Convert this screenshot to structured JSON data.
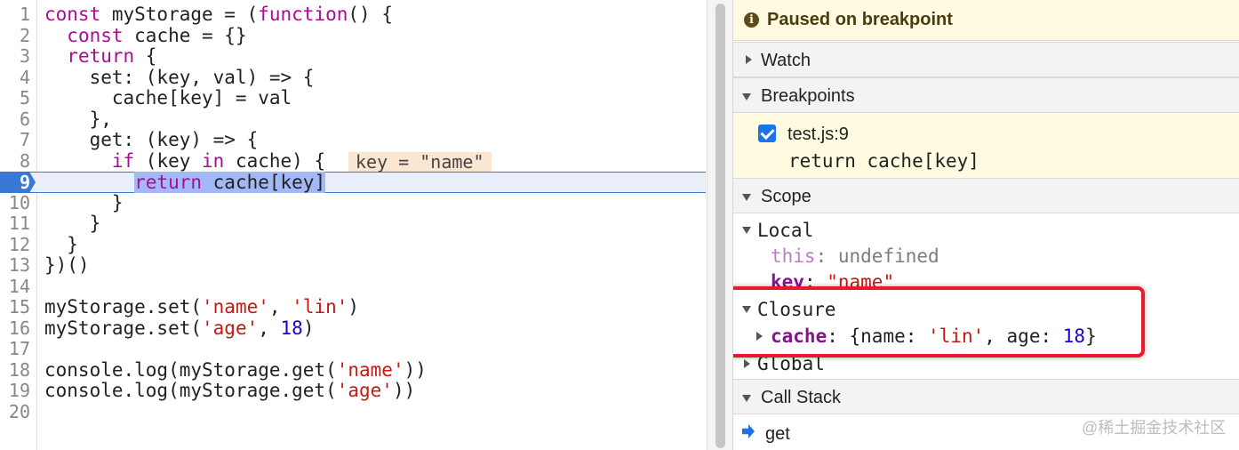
{
  "editor": {
    "lines": [
      {
        "n": "1",
        "tokens": [
          {
            "t": "const",
            "c": "kw"
          },
          {
            "t": " myStorage = ("
          },
          {
            "t": "function",
            "c": "kw"
          },
          {
            "t": "() {"
          }
        ]
      },
      {
        "n": "2",
        "tokens": [
          {
            "t": "  "
          },
          {
            "t": "const",
            "c": "kw"
          },
          {
            "t": " cache = {}"
          }
        ]
      },
      {
        "n": "3",
        "tokens": [
          {
            "t": "  "
          },
          {
            "t": "return",
            "c": "kw"
          },
          {
            "t": " {"
          }
        ]
      },
      {
        "n": "4",
        "tokens": [
          {
            "t": "    set: (key, val) => {"
          }
        ]
      },
      {
        "n": "5",
        "tokens": [
          {
            "t": "      cache[key] = val"
          }
        ]
      },
      {
        "n": "6",
        "tokens": [
          {
            "t": "    },"
          }
        ]
      },
      {
        "n": "7",
        "tokens": [
          {
            "t": "    get: (key) => {"
          }
        ]
      },
      {
        "n": "8",
        "tokens": [
          {
            "t": "      "
          },
          {
            "t": "if",
            "c": "kw"
          },
          {
            "t": " (key "
          },
          {
            "t": "in",
            "c": "kw"
          },
          {
            "t": " cache) {"
          }
        ]
      },
      {
        "n": "9",
        "tokens": [
          {
            "t": "        "
          },
          {
            "t": "return",
            "c": "kw"
          },
          {
            "t": " cache[key]"
          }
        ]
      },
      {
        "n": "10",
        "tokens": [
          {
            "t": "      }"
          }
        ]
      },
      {
        "n": "11",
        "tokens": [
          {
            "t": "    }"
          }
        ]
      },
      {
        "n": "12",
        "tokens": [
          {
            "t": "  }"
          }
        ]
      },
      {
        "n": "13",
        "tokens": [
          {
            "t": "})()"
          }
        ]
      },
      {
        "n": "14",
        "tokens": []
      },
      {
        "n": "15",
        "tokens": [
          {
            "t": "myStorage.set("
          },
          {
            "t": "'name'",
            "c": "str"
          },
          {
            "t": ", "
          },
          {
            "t": "'lin'",
            "c": "str"
          },
          {
            "t": ")"
          }
        ]
      },
      {
        "n": "16",
        "tokens": [
          {
            "t": "myStorage.set("
          },
          {
            "t": "'age'",
            "c": "str"
          },
          {
            "t": ", "
          },
          {
            "t": "18",
            "c": "num"
          },
          {
            "t": ")"
          }
        ]
      },
      {
        "n": "17",
        "tokens": []
      },
      {
        "n": "18",
        "tokens": [
          {
            "t": "console.log(myStorage.get("
          },
          {
            "t": "'name'",
            "c": "str"
          },
          {
            "t": "))"
          }
        ]
      },
      {
        "n": "19",
        "tokens": [
          {
            "t": "console.log(myStorage.get("
          },
          {
            "t": "'age'",
            "c": "str"
          },
          {
            "t": "))"
          }
        ]
      },
      {
        "n": "20",
        "tokens": []
      }
    ],
    "current_line": "9",
    "inline_value": "key = \"name\""
  },
  "debugger": {
    "paused_message": "Paused on breakpoint",
    "sections": {
      "watch": "Watch",
      "breakpoints": "Breakpoints",
      "scope": "Scope",
      "call_stack": "Call Stack"
    },
    "breakpoint": {
      "checked": true,
      "location": "test.js:9",
      "code": "return cache[key]"
    },
    "scope": {
      "local_label": "Local",
      "this_name": "this",
      "this_value": "undefined",
      "key_name": "key",
      "key_value": "\"name\"",
      "closure_label": "Closure",
      "cache_name": "cache",
      "cache_value": {
        "open": "{name: ",
        "name_val": "'lin'",
        "mid": ", age: ",
        "age_val": "18",
        "close": "}"
      },
      "global_label": "Global"
    },
    "call_stack_frames": [
      "get"
    ]
  },
  "watermark": "@稀土掘金技术社区",
  "colors": {
    "keyword": "#aa0d91",
    "string": "#c41a16",
    "number": "#1c00cf",
    "current_line_marker": "#3a78d6",
    "paused_banner": "#fffbe0",
    "highlight_box": "#e8192c"
  }
}
